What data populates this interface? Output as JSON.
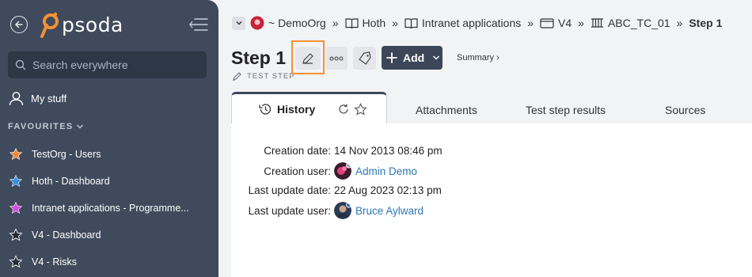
{
  "sidebar": {
    "logo_text": "psoda",
    "search_placeholder": "Search everywhere",
    "my_stuff": "My stuff",
    "favourites_header": "FAVOURITES",
    "favourites": [
      {
        "label": "TestOrg - Users",
        "color": "#f0893a"
      },
      {
        "label": "Hoth - Dashboard",
        "color": "#3b8fe0"
      },
      {
        "label": "Intranet applications - Programme...",
        "color": "#d34be0"
      },
      {
        "label": "V4 - Dashboard",
        "color": "#222a36"
      },
      {
        "label": "V4 - Risks",
        "color": "#222a36"
      }
    ]
  },
  "breadcrumb": {
    "org": "~ DemoOrg",
    "items": [
      "Hoth",
      "Intranet applications",
      "V4",
      "ABC_TC_01"
    ],
    "current": "Step 1"
  },
  "header": {
    "title": "Step 1",
    "type_label": "TEST STEP",
    "add_label": "Add",
    "summary_label": "Summary ›"
  },
  "tabs": {
    "active": "History",
    "others": [
      "Attachments",
      "Test step results",
      "Sources"
    ]
  },
  "history": {
    "creation_date_label": "Creation date:",
    "creation_date": "14 Nov 2013 08:46 pm",
    "creation_user_label": "Creation user:",
    "creation_user": "Admin Demo",
    "update_date_label": "Last update date:",
    "update_date": "22 Aug 2023 02:13 pm",
    "update_user_label": "Last update user:",
    "update_user": "Bruce Aylward"
  },
  "colors": {
    "sidebar_bg": "#3f4a5c",
    "accent_orange": "#f39233",
    "link_blue": "#2e77b4",
    "button_dark": "#3d4658"
  }
}
